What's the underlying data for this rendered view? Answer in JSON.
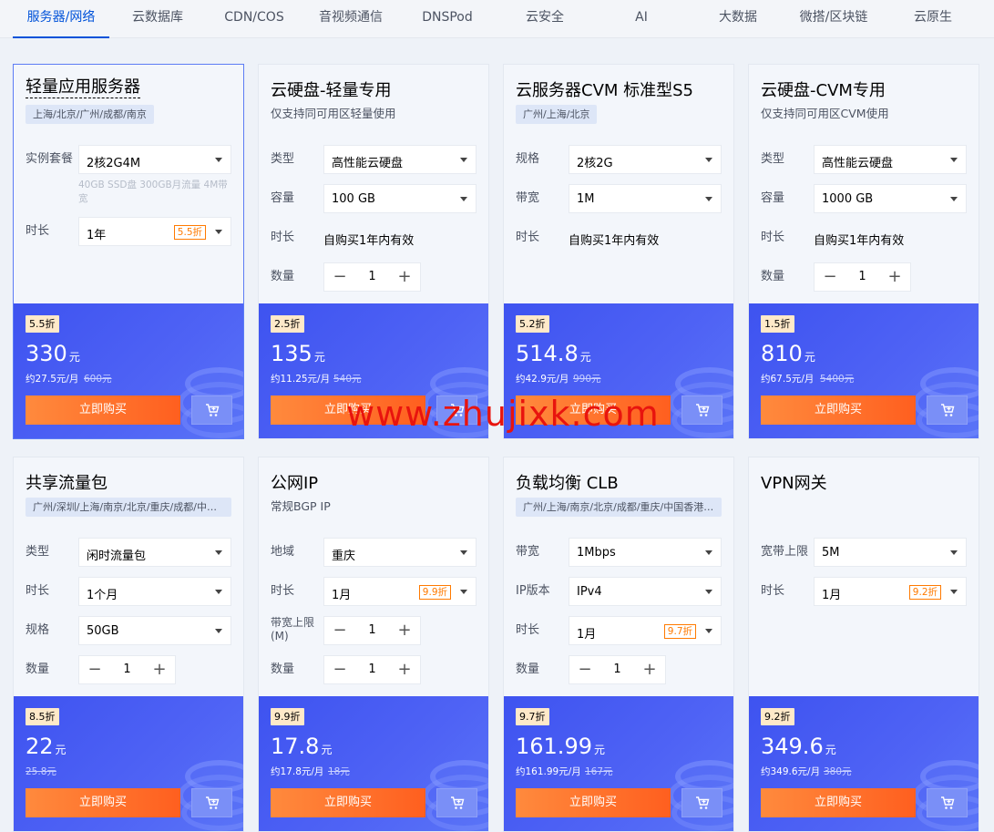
{
  "tabs": [
    "服务器/网络",
    "云数据库",
    "CDN/COS",
    "音视频通信",
    "DNSPod",
    "云安全",
    "AI",
    "大数据",
    "微搭/区块链",
    "云原生"
  ],
  "buy_label": "立即购买",
  "cards": [
    {
      "title": "轻量应用服务器",
      "region": "上海/北京/广州/成都/南京",
      "rows": [
        {
          "label": "实例套餐",
          "value": "2核2G4M"
        },
        {
          "label": "时长",
          "value": "1年",
          "discount": "5.5折"
        }
      ],
      "note": "40GB SSD盘 300GB月流量 4M带宽",
      "badge": "5.5折",
      "price": "330",
      "unit": "元",
      "per_month": "约27.5元/月",
      "original": "600元"
    },
    {
      "title": "云硬盘-轻量专用",
      "subtitle": "仅支持同可用区轻量使用",
      "rows": [
        {
          "label": "类型",
          "value": "高性能云硬盘"
        },
        {
          "label": "容量",
          "value": "100 GB"
        },
        {
          "label": "时长",
          "text": "自购买1年内有效"
        },
        {
          "label": "数量",
          "qty": "1"
        }
      ],
      "badge": "2.5折",
      "price": "135",
      "unit": "元",
      "per_month": "约11.25元/月",
      "original": "540元"
    },
    {
      "title": "云服务器CVM 标准型S5",
      "region": "广州/上海/北京",
      "rows": [
        {
          "label": "规格",
          "value": "2核2G"
        },
        {
          "label": "带宽",
          "value": "1M"
        },
        {
          "label": "时长",
          "text": "自购买1年内有效"
        }
      ],
      "badge": "5.2折",
      "price": "514.8",
      "unit": "元",
      "per_month": "约42.9元/月",
      "original": "990元"
    },
    {
      "title": "云硬盘-CVM专用",
      "subtitle": "仅支持同可用区CVM使用",
      "rows": [
        {
          "label": "类型",
          "value": "高性能云硬盘"
        },
        {
          "label": "容量",
          "value": "1000 GB"
        },
        {
          "label": "时长",
          "text": "自购买1年内有效"
        },
        {
          "label": "数量",
          "qty": "1"
        }
      ],
      "badge": "1.5折",
      "price": "810",
      "unit": "元",
      "per_month": "约67.5元/月",
      "original": "5400元"
    },
    {
      "title": "共享流量包",
      "region": "广州/深圳/上海/南京/北京/重庆/成都/中国…",
      "rows": [
        {
          "label": "类型",
          "value": "闲时流量包"
        },
        {
          "label": "时长",
          "value": "1个月"
        },
        {
          "label": "规格",
          "value": "50GB"
        },
        {
          "label": "数量",
          "qty": "1"
        }
      ],
      "badge": "8.5折",
      "price": "22",
      "unit": "元",
      "per_month": "",
      "original": "25.8元"
    },
    {
      "title": "公网IP",
      "subtitle": "常规BGP IP",
      "rows": [
        {
          "label": "地域",
          "value": "重庆"
        },
        {
          "label": "时长",
          "value": "1月",
          "discount": "9.9折"
        },
        {
          "label": "带宽上限\n(M)",
          "qty": "1"
        },
        {
          "label": "数量",
          "qty": "1"
        }
      ],
      "badge": "9.9折",
      "price": "17.8",
      "unit": "元",
      "per_month": "约17.8元/月",
      "original": "18元"
    },
    {
      "title": "负载均衡 CLB",
      "region": "广州/上海/南京/北京/成都/重庆/中国香港/…",
      "rows": [
        {
          "label": "带宽",
          "value": "1Mbps"
        },
        {
          "label": "IP版本",
          "value": "IPv4"
        },
        {
          "label": "时长",
          "value": "1月",
          "discount": "9.7折"
        },
        {
          "label": "数量",
          "qty": "1"
        }
      ],
      "badge": "9.7折",
      "price": "161.99",
      "unit": "元",
      "per_month": "约161.99元/月",
      "original": "167元"
    },
    {
      "title": "VPN网关",
      "rows": [
        {
          "label": "宽带上限",
          "value": "5M"
        },
        {
          "label": "时长",
          "value": "1月",
          "discount": "9.2折"
        }
      ],
      "badge": "9.2折",
      "price": "349.6",
      "unit": "元",
      "per_month": "约349.6元/月",
      "original": "380元"
    }
  ],
  "watermark": "www.zhujixk.com"
}
